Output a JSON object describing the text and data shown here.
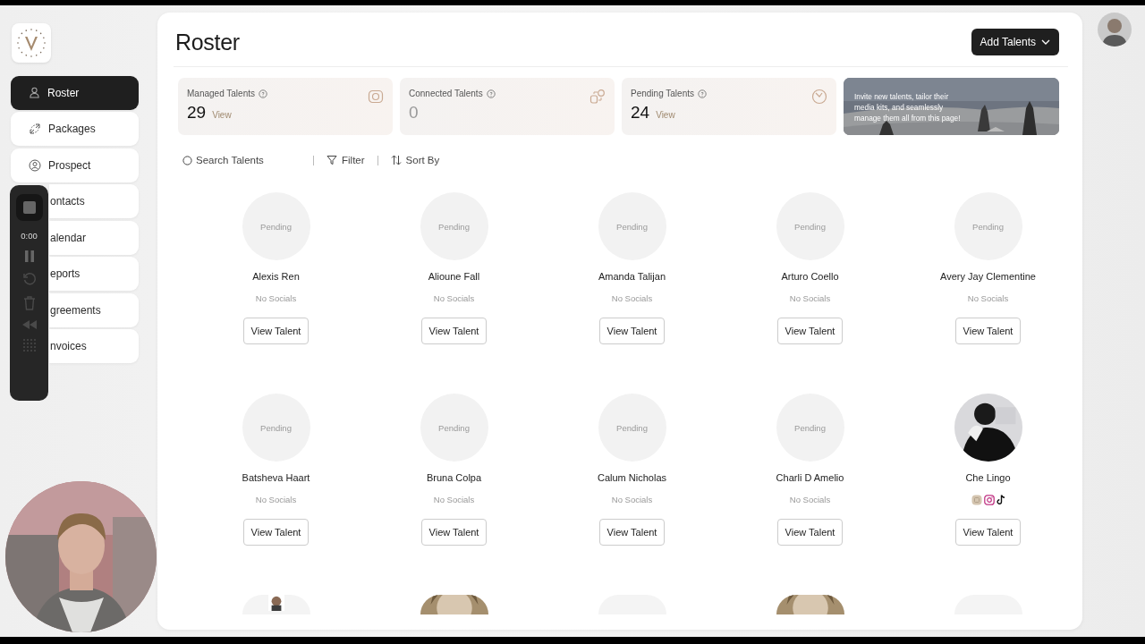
{
  "sidebar": {
    "items": [
      {
        "label": "Roster",
        "selected": true
      },
      {
        "label": "Packages",
        "selected": false
      },
      {
        "label": "Prospect",
        "selected": false
      },
      {
        "label": "ontacts",
        "selected": false
      },
      {
        "label": "alendar",
        "selected": false
      },
      {
        "label": "eports",
        "selected": false
      },
      {
        "label": "greements",
        "selected": false
      },
      {
        "label": "nvoices",
        "selected": false
      }
    ]
  },
  "recorder": {
    "timer": "0:00"
  },
  "header": {
    "title": "Roster",
    "add_button": "Add Talents"
  },
  "stats": [
    {
      "label": "Managed Talents",
      "value": "29",
      "link": "View",
      "dimmed": false
    },
    {
      "label": "Connected Talents",
      "value": "0",
      "dimmed": true
    },
    {
      "label": "Pending Talents",
      "value": "24",
      "link": "View",
      "dimmed": false
    }
  ],
  "banner": {
    "text": "Invite new talents, tailor their media kits, and seamlessly manage them all from this page!"
  },
  "toolbar": {
    "search_placeholder": "Search Talents",
    "filter": "Filter",
    "sort": "Sort By"
  },
  "talents": [
    {
      "name": "Alexis Ren",
      "avatar": {
        "kind": "pending",
        "label": "Pending"
      },
      "no_socials": "No Socials",
      "button": "View Talent"
    },
    {
      "name": "Alioune Fall",
      "avatar": {
        "kind": "pending",
        "label": "Pending"
      },
      "no_socials": "No Socials",
      "button": "View Talent"
    },
    {
      "name": "Amanda Talijan",
      "avatar": {
        "kind": "pending",
        "label": "Pending"
      },
      "no_socials": "No Socials",
      "button": "View Talent"
    },
    {
      "name": "Arturo Coello",
      "avatar": {
        "kind": "pending",
        "label": "Pending"
      },
      "no_socials": "No Socials",
      "button": "View Talent"
    },
    {
      "name": "Avery Jay Clementine",
      "avatar": {
        "kind": "pending",
        "label": "Pending"
      },
      "no_socials": "No Socials",
      "button": "View Talent"
    },
    {
      "name": "Batsheva Haart",
      "avatar": {
        "kind": "pending",
        "label": "Pending"
      },
      "no_socials": "No Socials",
      "button": "View Talent"
    },
    {
      "name": "Bruna Colpa",
      "avatar": {
        "kind": "pending",
        "label": "Pending"
      },
      "no_socials": "No Socials",
      "button": "View Talent"
    },
    {
      "name": "Calum Nicholas",
      "avatar": {
        "kind": "pending",
        "label": "Pending"
      },
      "no_socials": "No Socials",
      "button": "View Talent"
    },
    {
      "name": "Charli D Amelio",
      "avatar": {
        "kind": "pending",
        "label": "Pending"
      },
      "no_socials": "No Socials",
      "button": "View Talent"
    },
    {
      "name": "Che Lingo",
      "avatar": {
        "kind": "picture"
      },
      "socials": [
        {
          "kind": "media"
        },
        {
          "kind": "instagram"
        },
        {
          "kind": "tiktok"
        }
      ],
      "button": "View Talent"
    }
  ],
  "talents_cut_off": [
    {
      "kind": "small-picture"
    },
    {
      "kind": "picture"
    },
    {
      "kind": "blank"
    },
    {
      "kind": "picture"
    },
    {
      "kind": "blank"
    }
  ]
}
